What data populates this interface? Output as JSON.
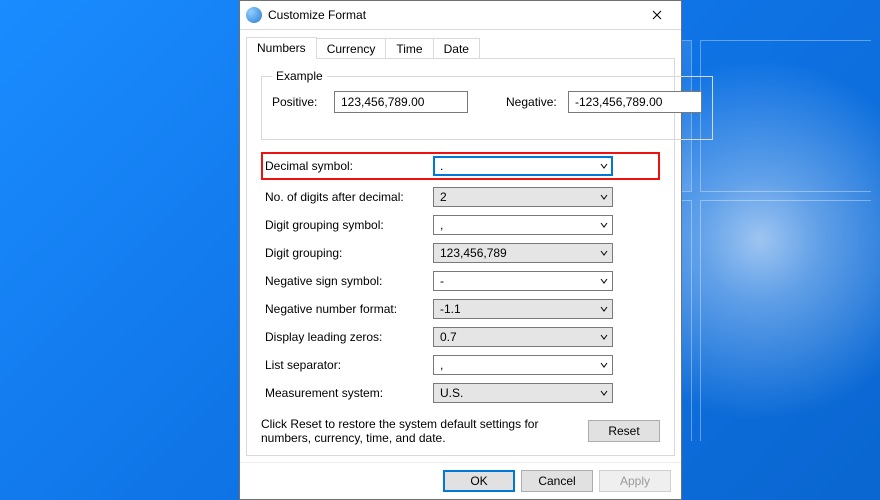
{
  "window": {
    "title": "Customize Format"
  },
  "tabs": {
    "numbers": "Numbers",
    "currency": "Currency",
    "time": "Time",
    "date": "Date",
    "active": "numbers"
  },
  "example": {
    "legend": "Example",
    "positive_label": "Positive:",
    "positive_value": "123,456,789.00",
    "negative_label": "Negative:",
    "negative_value": "-123,456,789.00"
  },
  "settings": {
    "decimal_symbol": {
      "label": "Decimal symbol:",
      "value": ".",
      "shaded": false,
      "highlight": true,
      "focused": true
    },
    "digits_after_decimal": {
      "label": "No. of digits after decimal:",
      "value": "2",
      "shaded": true
    },
    "digit_grouping_symbol": {
      "label": "Digit grouping symbol:",
      "value": ",",
      "shaded": false
    },
    "digit_grouping": {
      "label": "Digit grouping:",
      "value": "123,456,789",
      "shaded": true
    },
    "negative_sign_symbol": {
      "label": "Negative sign symbol:",
      "value": "-",
      "shaded": false
    },
    "negative_number_format": {
      "label": "Negative number format:",
      "value": "-1.1",
      "shaded": true
    },
    "display_leading_zeros": {
      "label": "Display leading zeros:",
      "value": "0.7",
      "shaded": true
    },
    "list_separator": {
      "label": "List separator:",
      "value": ",",
      "shaded": false
    },
    "measurement_system": {
      "label": "Measurement system:",
      "value": "U.S.",
      "shaded": true
    }
  },
  "reset": {
    "text": "Click Reset to restore the system default settings for numbers, currency, time, and date.",
    "button": "Reset"
  },
  "footer": {
    "ok": "OK",
    "cancel": "Cancel",
    "apply": "Apply"
  }
}
